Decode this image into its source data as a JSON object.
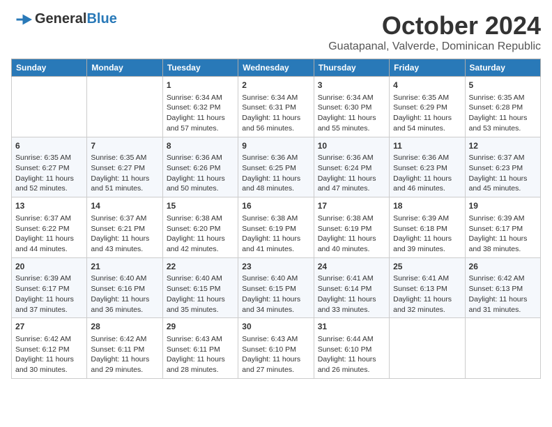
{
  "logo": {
    "general": "General",
    "blue": "Blue"
  },
  "header": {
    "month": "October 2024",
    "location": "Guatapanal, Valverde, Dominican Republic"
  },
  "weekdays": [
    "Sunday",
    "Monday",
    "Tuesday",
    "Wednesday",
    "Thursday",
    "Friday",
    "Saturday"
  ],
  "weeks": [
    [
      {
        "day": "",
        "info": ""
      },
      {
        "day": "",
        "info": ""
      },
      {
        "day": "1",
        "info": "Sunrise: 6:34 AM\nSunset: 6:32 PM\nDaylight: 11 hours and 57 minutes."
      },
      {
        "day": "2",
        "info": "Sunrise: 6:34 AM\nSunset: 6:31 PM\nDaylight: 11 hours and 56 minutes."
      },
      {
        "day": "3",
        "info": "Sunrise: 6:34 AM\nSunset: 6:30 PM\nDaylight: 11 hours and 55 minutes."
      },
      {
        "day": "4",
        "info": "Sunrise: 6:35 AM\nSunset: 6:29 PM\nDaylight: 11 hours and 54 minutes."
      },
      {
        "day": "5",
        "info": "Sunrise: 6:35 AM\nSunset: 6:28 PM\nDaylight: 11 hours and 53 minutes."
      }
    ],
    [
      {
        "day": "6",
        "info": "Sunrise: 6:35 AM\nSunset: 6:27 PM\nDaylight: 11 hours and 52 minutes."
      },
      {
        "day": "7",
        "info": "Sunrise: 6:35 AM\nSunset: 6:27 PM\nDaylight: 11 hours and 51 minutes."
      },
      {
        "day": "8",
        "info": "Sunrise: 6:36 AM\nSunset: 6:26 PM\nDaylight: 11 hours and 50 minutes."
      },
      {
        "day": "9",
        "info": "Sunrise: 6:36 AM\nSunset: 6:25 PM\nDaylight: 11 hours and 48 minutes."
      },
      {
        "day": "10",
        "info": "Sunrise: 6:36 AM\nSunset: 6:24 PM\nDaylight: 11 hours and 47 minutes."
      },
      {
        "day": "11",
        "info": "Sunrise: 6:36 AM\nSunset: 6:23 PM\nDaylight: 11 hours and 46 minutes."
      },
      {
        "day": "12",
        "info": "Sunrise: 6:37 AM\nSunset: 6:23 PM\nDaylight: 11 hours and 45 minutes."
      }
    ],
    [
      {
        "day": "13",
        "info": "Sunrise: 6:37 AM\nSunset: 6:22 PM\nDaylight: 11 hours and 44 minutes."
      },
      {
        "day": "14",
        "info": "Sunrise: 6:37 AM\nSunset: 6:21 PM\nDaylight: 11 hours and 43 minutes."
      },
      {
        "day": "15",
        "info": "Sunrise: 6:38 AM\nSunset: 6:20 PM\nDaylight: 11 hours and 42 minutes."
      },
      {
        "day": "16",
        "info": "Sunrise: 6:38 AM\nSunset: 6:19 PM\nDaylight: 11 hours and 41 minutes."
      },
      {
        "day": "17",
        "info": "Sunrise: 6:38 AM\nSunset: 6:19 PM\nDaylight: 11 hours and 40 minutes."
      },
      {
        "day": "18",
        "info": "Sunrise: 6:39 AM\nSunset: 6:18 PM\nDaylight: 11 hours and 39 minutes."
      },
      {
        "day": "19",
        "info": "Sunrise: 6:39 AM\nSunset: 6:17 PM\nDaylight: 11 hours and 38 minutes."
      }
    ],
    [
      {
        "day": "20",
        "info": "Sunrise: 6:39 AM\nSunset: 6:17 PM\nDaylight: 11 hours and 37 minutes."
      },
      {
        "day": "21",
        "info": "Sunrise: 6:40 AM\nSunset: 6:16 PM\nDaylight: 11 hours and 36 minutes."
      },
      {
        "day": "22",
        "info": "Sunrise: 6:40 AM\nSunset: 6:15 PM\nDaylight: 11 hours and 35 minutes."
      },
      {
        "day": "23",
        "info": "Sunrise: 6:40 AM\nSunset: 6:15 PM\nDaylight: 11 hours and 34 minutes."
      },
      {
        "day": "24",
        "info": "Sunrise: 6:41 AM\nSunset: 6:14 PM\nDaylight: 11 hours and 33 minutes."
      },
      {
        "day": "25",
        "info": "Sunrise: 6:41 AM\nSunset: 6:13 PM\nDaylight: 11 hours and 32 minutes."
      },
      {
        "day": "26",
        "info": "Sunrise: 6:42 AM\nSunset: 6:13 PM\nDaylight: 11 hours and 31 minutes."
      }
    ],
    [
      {
        "day": "27",
        "info": "Sunrise: 6:42 AM\nSunset: 6:12 PM\nDaylight: 11 hours and 30 minutes."
      },
      {
        "day": "28",
        "info": "Sunrise: 6:42 AM\nSunset: 6:11 PM\nDaylight: 11 hours and 29 minutes."
      },
      {
        "day": "29",
        "info": "Sunrise: 6:43 AM\nSunset: 6:11 PM\nDaylight: 11 hours and 28 minutes."
      },
      {
        "day": "30",
        "info": "Sunrise: 6:43 AM\nSunset: 6:10 PM\nDaylight: 11 hours and 27 minutes."
      },
      {
        "day": "31",
        "info": "Sunrise: 6:44 AM\nSunset: 6:10 PM\nDaylight: 11 hours and 26 minutes."
      },
      {
        "day": "",
        "info": ""
      },
      {
        "day": "",
        "info": ""
      }
    ]
  ]
}
